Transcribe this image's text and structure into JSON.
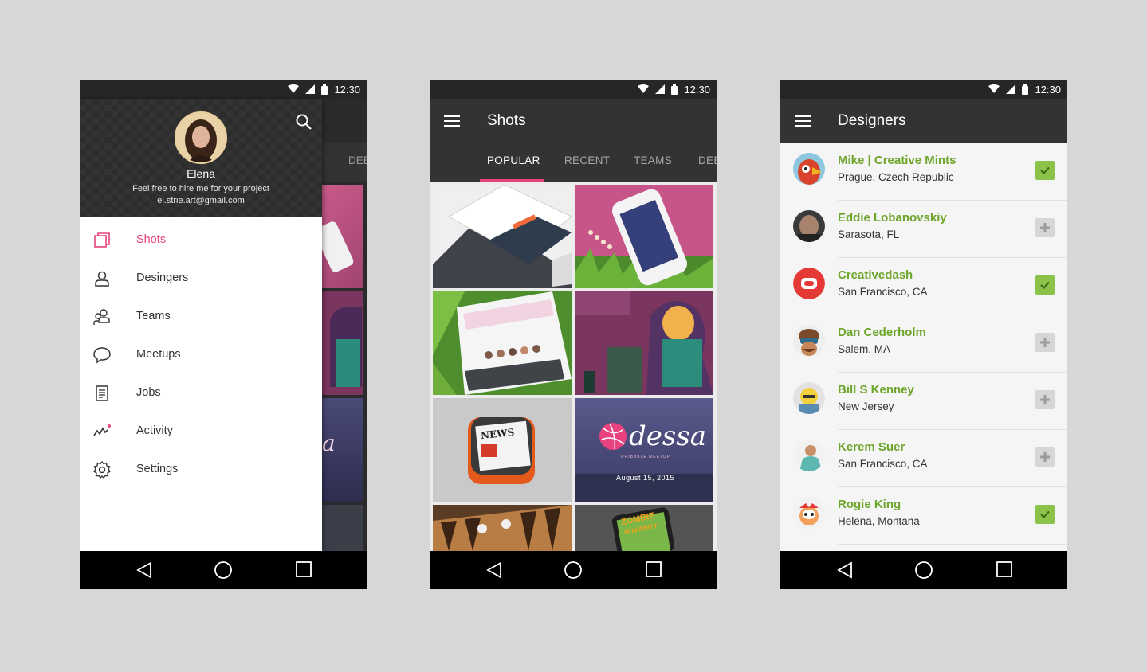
{
  "status": {
    "time": "12:30"
  },
  "phone1": {
    "profile": {
      "name": "Elena",
      "tagline": "Feel free to hire me for your project",
      "email": "el.strie.art@gmail.com"
    },
    "peek_tab": "DEE",
    "menu": [
      {
        "label": "Shots",
        "icon": "shots-icon",
        "active": true
      },
      {
        "label": "Desingers",
        "icon": "person-icon",
        "active": false
      },
      {
        "label": "Teams",
        "icon": "teams-icon",
        "active": false
      },
      {
        "label": "Meetups",
        "icon": "chat-bubble-icon",
        "active": false
      },
      {
        "label": "Jobs",
        "icon": "document-icon",
        "active": false
      },
      {
        "label": "Activity",
        "icon": "activity-icon",
        "active": false
      },
      {
        "label": "Settings",
        "icon": "gear-icon",
        "active": false
      }
    ]
  },
  "phone2": {
    "title": "Shots",
    "tabs": [
      "POPULAR",
      "RECENT",
      "TEAMS",
      "DEE"
    ],
    "shots": {
      "news_label": "NEWS",
      "odessa_label": "dessa",
      "odessa_sub": "DRIBBBLE MEETUP",
      "odessa_date": "August 15, 2015",
      "zombie_label": "ZOMBIE",
      "zombie_sub": "HUMANITY"
    }
  },
  "phone3": {
    "title": "Designers",
    "designers": [
      {
        "name": "Mike | Creative Mints",
        "location": "Prague, Czech Republic",
        "followed": true
      },
      {
        "name": "Eddie Lobanovskiy",
        "location": "Sarasota, FL",
        "followed": false
      },
      {
        "name": "Creativedash",
        "location": "San Francisco, CA",
        "followed": true
      },
      {
        "name": "Dan Cederholm",
        "location": "Salem, MA",
        "followed": false
      },
      {
        "name": "Bill S Kenney",
        "location": "New Jersey",
        "followed": false
      },
      {
        "name": "Kerem Suer",
        "location": "San Francisco, CA",
        "followed": false
      },
      {
        "name": "Rogie King",
        "location": "Helena, Montana",
        "followed": true
      }
    ]
  },
  "colors": {
    "accent": "#e8437e",
    "name_green": "#6ea52b",
    "toggle_on": "#8bc34a",
    "appbar": "#333333"
  }
}
